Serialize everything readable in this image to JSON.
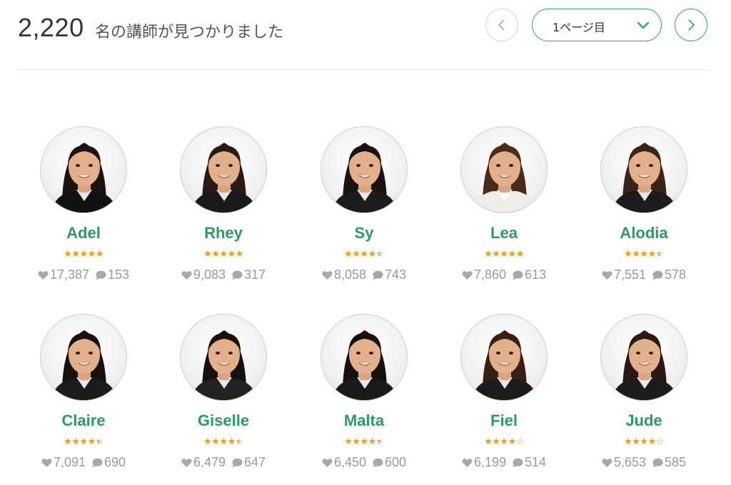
{
  "header": {
    "result_count": "2,220",
    "result_label": "名の講師が見つかりました",
    "pager": {
      "page_label": "1ページ目",
      "prev_icon": "chevron-left-icon",
      "next_icon": "chevron-right-icon",
      "select_icon": "chevron-down-icon"
    }
  },
  "colors": {
    "accent_green": "#2e9a63",
    "star_orange": "#f29b0c",
    "muted_gray": "#9a9a9a"
  },
  "teachers": [
    {
      "name": "Adel",
      "rating": 5.0,
      "favorites": "17,387",
      "reviews": "153",
      "hair": "#1c1310",
      "top": "#111"
    },
    {
      "name": "Rhey",
      "rating": 5.0,
      "favorites": "9,083",
      "reviews": "317",
      "hair": "#2a1a12",
      "top": "#1a1a1a"
    },
    {
      "name": "Sy",
      "rating": 4.5,
      "favorites": "8,058",
      "reviews": "743",
      "hair": "#1a1210",
      "top": "#1c1c1c"
    },
    {
      "name": "Lea",
      "rating": 5.0,
      "favorites": "7,860",
      "reviews": "613",
      "hair": "#4a2a18",
      "top": "#f0ede8"
    },
    {
      "name": "Alodia",
      "rating": 4.5,
      "favorites": "7,551",
      "reviews": "578",
      "hair": "#3a2418",
      "top": "#1c1c1c"
    },
    {
      "name": "Claire",
      "rating": 4.5,
      "favorites": "7,091",
      "reviews": "690",
      "hair": "#16100e",
      "top": "#1c1c1c"
    },
    {
      "name": "Giselle",
      "rating": 4.5,
      "favorites": "6,479",
      "reviews": "647",
      "hair": "#16100e",
      "top": "#222"
    },
    {
      "name": "Malta",
      "rating": 4.5,
      "favorites": "6,450",
      "reviews": "600",
      "hair": "#16100e",
      "top": "#1a1a1a"
    },
    {
      "name": "Fiel",
      "rating": 4.0,
      "favorites": "6,199",
      "reviews": "514",
      "hair": "#3a1e12",
      "top": "#1c1c1c"
    },
    {
      "name": "Jude",
      "rating": 4.0,
      "favorites": "5,653",
      "reviews": "585",
      "hair": "#2a1812",
      "top": "#1c1c1c"
    }
  ]
}
